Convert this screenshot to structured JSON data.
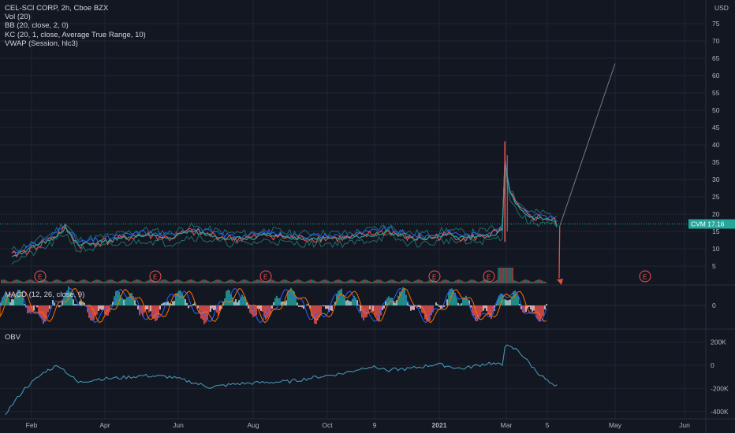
{
  "legend": {
    "title": "CEL-SCI CORP, 2h, Cboe BZX",
    "vol": "Vol (20)",
    "bb": "BB (20, close, 2, 0)",
    "kc": "KC (20, 1, close, Average True Range, 10)",
    "vwap": "VWAP (Session, hlc3)"
  },
  "currency_label": "USD",
  "price_tag": {
    "symbol": "CVM",
    "value": "17.16"
  },
  "macd_label": "MACD (12, 26, close, 9)",
  "obv_label": "OBV",
  "earnings_marker": "E",
  "colors": {
    "background": "#131722",
    "grid": "#1f2431",
    "price_line": "#26a69a",
    "bb_upper": "#2196f3",
    "red": "#ef5350",
    "teal": "#26a69a",
    "obv_line": "#4a9fbf",
    "drawing": "#787b86",
    "arrow": "#e0533d"
  },
  "chart_data": [
    {
      "type": "line",
      "name": "price",
      "x": [
        "2020-01-10",
        "2020-01-25",
        "2020-02-10",
        "2020-02-20",
        "2020-03-01",
        "2020-03-20",
        "2020-04-05",
        "2020-04-20",
        "2020-05-10",
        "2020-05-25",
        "2020-06-10",
        "2020-06-25",
        "2020-07-10",
        "2020-07-25",
        "2020-08-10",
        "2020-08-25",
        "2020-09-10",
        "2020-09-25",
        "2020-10-10",
        "2020-10-25",
        "2020-11-10",
        "2020-11-25",
        "2020-12-10",
        "2020-12-25",
        "2021-01-10",
        "2021-01-20",
        "2021-01-22",
        "2021-01-26",
        "2021-02-01",
        "2021-02-10",
        "2021-02-20",
        "2021-03-01",
        "2021-03-05"
      ],
      "y": [
        8,
        10,
        13,
        16,
        11,
        12,
        13,
        14,
        13,
        15,
        14,
        13,
        13,
        14,
        13,
        13,
        13,
        13,
        14,
        15,
        13,
        13,
        14,
        13,
        14,
        15,
        35,
        26,
        22,
        19,
        19,
        18,
        16
      ],
      "ylim": [
        0,
        80
      ],
      "yticks": [
        5,
        10,
        15,
        20,
        25,
        30,
        35,
        40,
        45,
        50,
        55,
        60,
        65,
        70,
        75
      ]
    },
    {
      "type": "bar",
      "name": "MACD",
      "yticks": [
        0
      ]
    },
    {
      "type": "line",
      "name": "OBV",
      "x": [
        "2020-01-05",
        "2020-01-20",
        "2020-02-05",
        "2020-02-15",
        "2020-03-01",
        "2020-03-15",
        "2020-04-01",
        "2020-04-20",
        "2020-05-10",
        "2020-05-25",
        "2020-06-10",
        "2020-07-01",
        "2020-07-20",
        "2020-08-10",
        "2020-09-01",
        "2020-09-20",
        "2020-10-10",
        "2020-10-25",
        "2020-11-10",
        "2020-12-01",
        "2020-12-20",
        "2021-01-10",
        "2021-01-20",
        "2021-01-22",
        "2021-02-01",
        "2021-02-15",
        "2021-03-01",
        "2021-03-05"
      ],
      "y": [
        -420000,
        -200000,
        -50000,
        0,
        -150000,
        -120000,
        -110000,
        -90000,
        -100000,
        -140000,
        -190000,
        -160000,
        -150000,
        -140000,
        -100000,
        -70000,
        -10000,
        -40000,
        -30000,
        10000,
        -30000,
        20000,
        0,
        170000,
        130000,
        -50000,
        -190000,
        -170000
      ],
      "yticks": [
        -400000,
        -200000,
        0,
        200000
      ],
      "ytick_labels": [
        "-400K",
        "-200K",
        "0",
        "200K"
      ]
    }
  ],
  "x_axis": {
    "labels": [
      "Feb",
      "Apr",
      "Jun",
      "Aug",
      "Oct",
      "9",
      "2021",
      "Mar",
      "5",
      "May",
      "Jun"
    ]
  }
}
